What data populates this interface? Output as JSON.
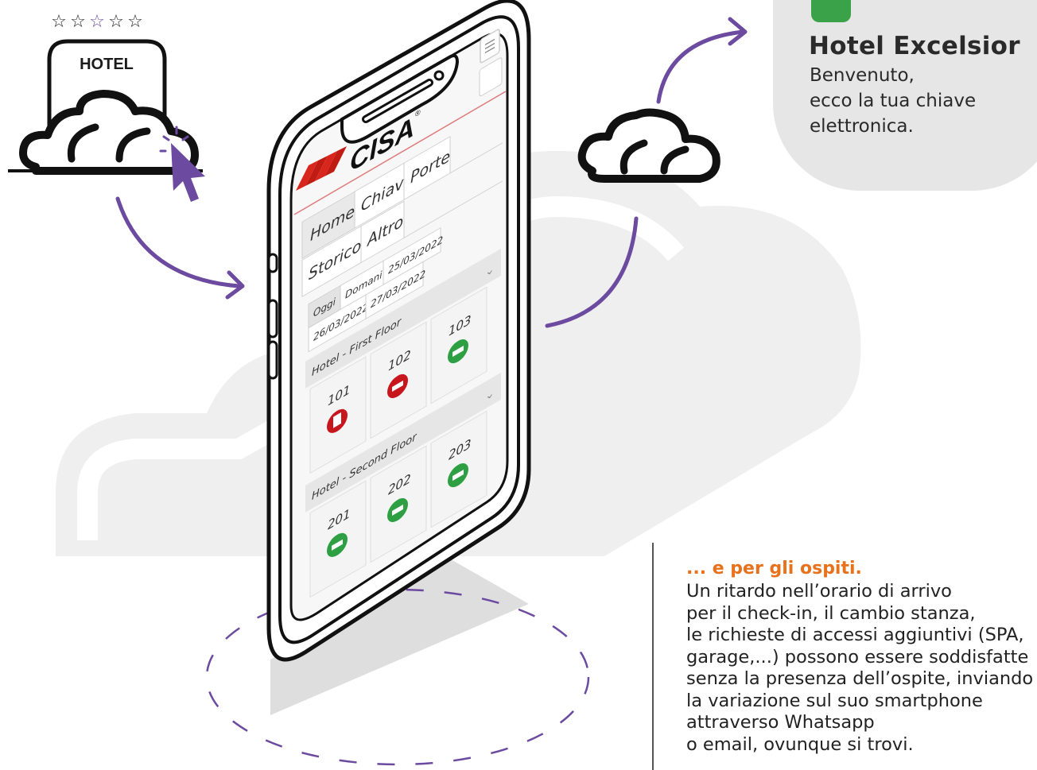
{
  "sign": {
    "stars": [
      "☆",
      "☆",
      "☆",
      "☆",
      "☆"
    ],
    "label": "HOTEL",
    "accent_color": "#6b4aa0"
  },
  "phone": {
    "logo": "CISA",
    "logo_trademark": "®",
    "menu_icon": "hamburger-menu-icon",
    "tabs": [
      "Home",
      "Chiavi",
      "Porte",
      "Storico",
      "Altro"
    ],
    "date_filters": [
      "Oggi",
      "Domani",
      "25/03/2022",
      "26/03/2022",
      "27/03/2022"
    ],
    "floors": [
      {
        "name": "Hotel - First Floor",
        "rooms": [
          {
            "number": "101",
            "status": "red",
            "icon": "door-icon"
          },
          {
            "number": "102",
            "status": "red",
            "icon": "bed-icon"
          },
          {
            "number": "103",
            "status": "green",
            "icon": "bed-icon"
          }
        ]
      },
      {
        "name": "Hotel - Second Floor",
        "rooms": [
          {
            "number": "201",
            "status": "green",
            "icon": "bed-icon"
          },
          {
            "number": "202",
            "status": "green",
            "icon": "bed-icon"
          },
          {
            "number": "203",
            "status": "green",
            "icon": "bed-icon"
          }
        ]
      }
    ],
    "status_colors": {
      "red": "#c8161d",
      "green": "#2ea043"
    }
  },
  "message": {
    "icon": "whatsapp-icon",
    "title": "Hotel Excelsior",
    "lines": [
      "Benvenuto,",
      "ecco la tua chiave",
      "elettronica."
    ]
  },
  "guests": {
    "title": "... e per gli ospiti.",
    "lines": [
      "Un ritardo nell’orario di arrivo",
      "per il check-in, il cambio stanza,",
      "le richieste di accessi aggiuntivi (SPA,",
      "garage,...) possono essere soddisfatte",
      "senza la presenza dell’ospite, inviando",
      "la variazione sul suo smartphone",
      "attraverso Whatsapp",
      "o email, ovunque si trovi."
    ],
    "title_color": "#e8721c"
  },
  "colors": {
    "accent": "#6b4aa0",
    "brand_red": "#d9261c",
    "bubble": "#e6e6e6"
  }
}
